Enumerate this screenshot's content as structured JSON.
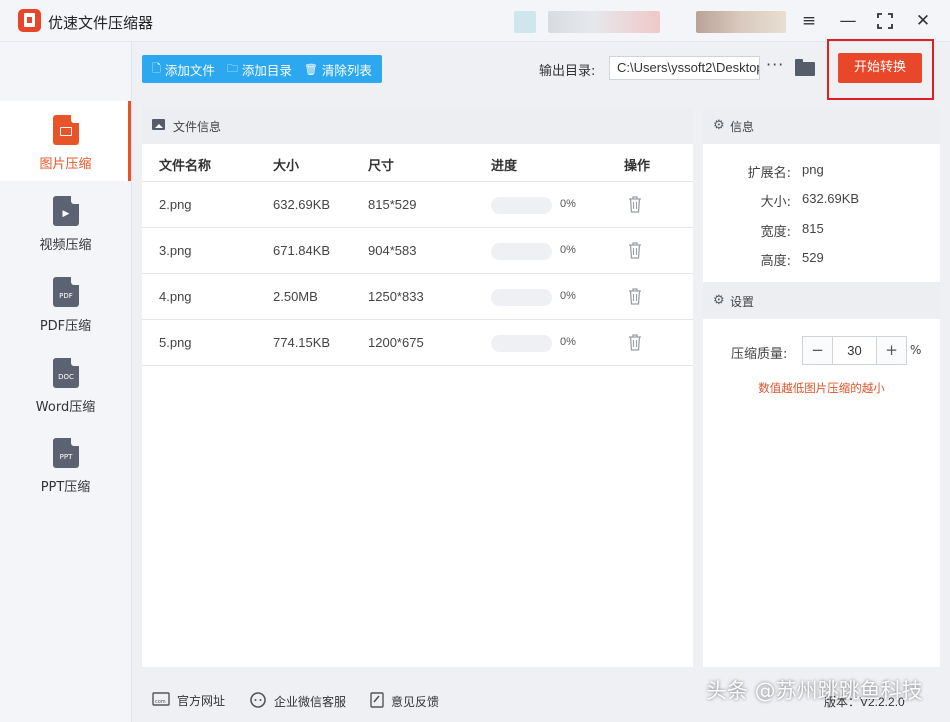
{
  "app": {
    "title": "优速文件压缩器"
  },
  "toolbar": {
    "add_file": "添加文件",
    "add_dir": "添加目录",
    "clear_list": "清除列表",
    "output_label": "输出目录:",
    "output_path": "C:\\Users\\yssoft2\\Desktop",
    "more": "···",
    "start": "开始转换"
  },
  "sidebar": {
    "items": [
      {
        "label": "图片压缩",
        "tag": "",
        "active": true
      },
      {
        "label": "视频压缩",
        "tag": "▶",
        "active": false
      },
      {
        "label": "PDF压缩",
        "tag": "PDF",
        "active": false
      },
      {
        "label": "Word压缩",
        "tag": "DOC",
        "active": false
      },
      {
        "label": "PPT压缩",
        "tag": "PPT",
        "active": false
      }
    ]
  },
  "file_panel": {
    "title": "文件信息",
    "columns": [
      "文件名称",
      "大小",
      "尺寸",
      "进度",
      "操作"
    ],
    "rows": [
      {
        "name": "2.png",
        "size": "632.69KB",
        "dim": "815*529",
        "progress": 0,
        "progress_text": "0%"
      },
      {
        "name": "3.png",
        "size": "671.84KB",
        "dim": "904*583",
        "progress": 0,
        "progress_text": "0%"
      },
      {
        "name": "4.png",
        "size": "2.50MB",
        "dim": "1250*833",
        "progress": 0,
        "progress_text": "0%"
      },
      {
        "name": "5.png",
        "size": "774.15KB",
        "dim": "1200*675",
        "progress": 0,
        "progress_text": "0%"
      }
    ]
  },
  "info": {
    "title": "信息",
    "ext_label": "扩展名:",
    "ext": "png",
    "size_label": "大小:",
    "size": "632.69KB",
    "width_label": "宽度:",
    "width": "815",
    "height_label": "高度:",
    "height": "529"
  },
  "settings": {
    "title": "设置",
    "quality_label": "压缩质量:",
    "minus": "−",
    "plus": "+",
    "quality": "30",
    "unit": "%",
    "hint": "数值越低图片压缩的越小"
  },
  "footer": {
    "website": "官方网址",
    "wechat": "企业微信客服",
    "feedback": "意见反馈",
    "version": "版本：V2.2.2.0",
    "watermark": "头条 @苏州跳跳鱼科技"
  },
  "colors": {
    "accent": "#e8532a",
    "toolbar_blue": "#2ba8f0",
    "highlight_red": "#e02020"
  }
}
